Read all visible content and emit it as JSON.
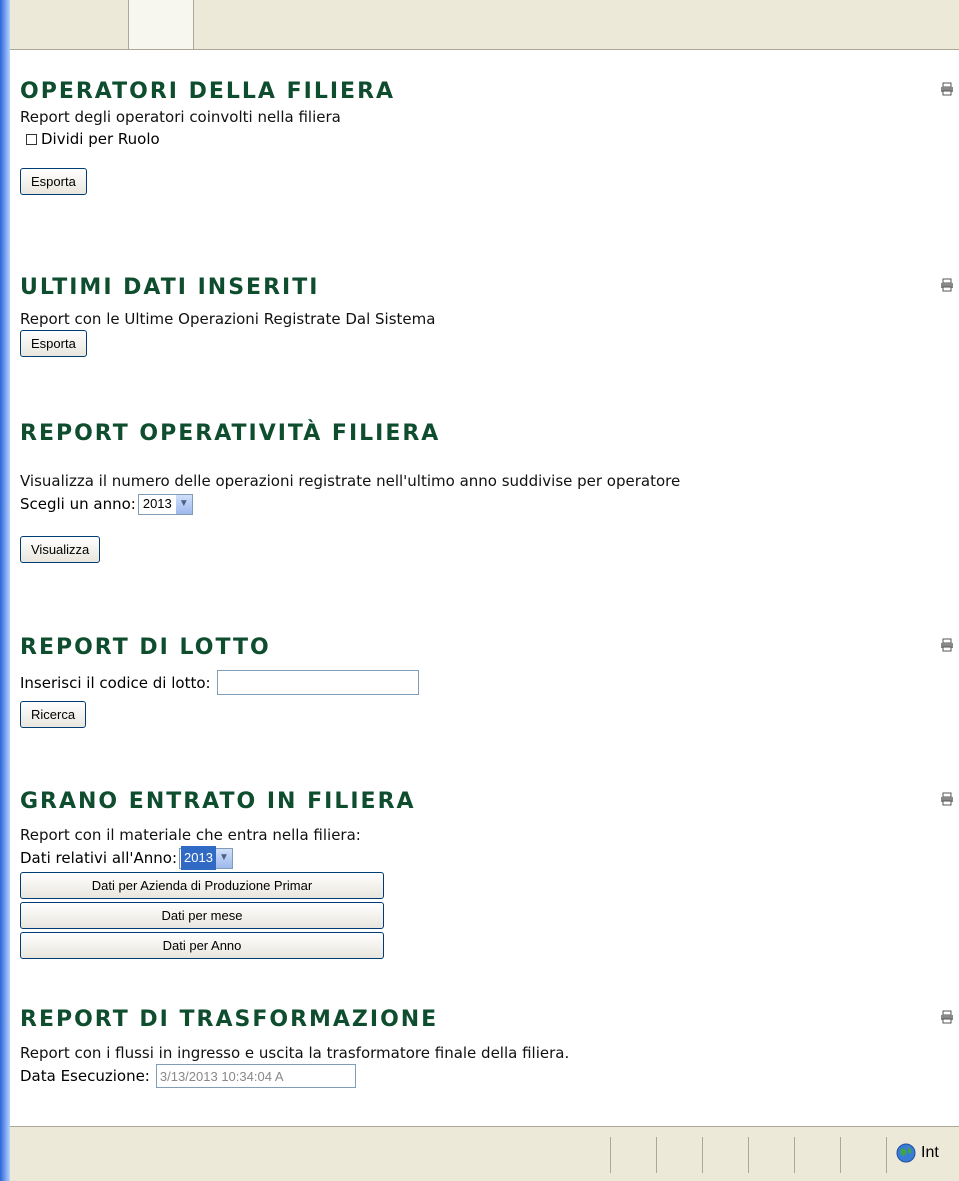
{
  "sections": {
    "operatori": {
      "title": "OPERATORI DELLA FILIERA",
      "description": "Report degli operatori coinvolti nella filiera",
      "checkbox_label": "Dividi per Ruolo",
      "export_label": "Esporta"
    },
    "ultimi": {
      "title": "ULTIMI DATI INSERITI",
      "description": "Report con le Ultime Operazioni Registrate Dal Sistema",
      "export_label": "Esporta"
    },
    "operativita": {
      "title": "REPORT OPERATIVITÀ FILIERA",
      "description": "Visualizza il numero delle operazioni registrate nell'ultimo anno suddivise per operatore",
      "year_label": "Scegli un anno:",
      "year_value": "2013",
      "view_label": "Visualizza"
    },
    "lotto": {
      "title": "REPORT DI LOTTO",
      "code_label": "Inserisci il codice di lotto:",
      "code_value": "",
      "search_label": "Ricerca"
    },
    "grano": {
      "title": "GRANO ENTRATO IN FILIERA",
      "description": "Report con il materiale che entra nella filiera:",
      "year_label": "Dati relativi all'Anno:",
      "year_value": "2013",
      "btn_azienda": "Dati per Azienda di Produzione Primar",
      "btn_mese": "Dati per mese",
      "btn_anno": "Dati per Anno"
    },
    "trasformazione": {
      "title": "REPORT DI TRASFORMAZIONE",
      "description": "Report con i flussi in ingresso e uscita la trasformatore finale della filiera.",
      "date_label": "Data Esecuzione:",
      "date_value": "3/13/2013 10:34:04 A"
    }
  },
  "status_bar": {
    "zone_text": "Int"
  },
  "icons": {
    "print": "print-icon",
    "globe": "globe-icon"
  }
}
